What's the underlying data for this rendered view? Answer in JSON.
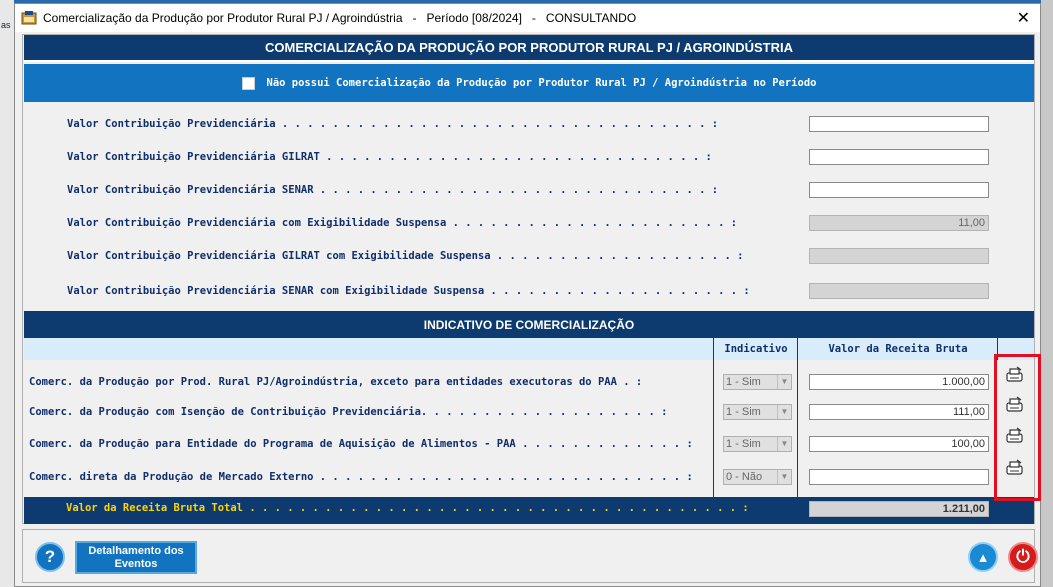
{
  "background": {
    "left_text": "as"
  },
  "window": {
    "title": "Comercialização da Produção por Produtor Rural PJ / Agroindústria   -   Período [08/2024]   -   CONSULTANDO",
    "close_glyph": "✕"
  },
  "header": {
    "title": "COMERCIALIZAÇÃO DA PRODUÇÃO POR PRODUTOR RURAL PJ / AGROINDÚSTRIA",
    "checkbox_label": "Não possui Comercialização da Produção por Produtor Rural PJ / Agroindústria no Período"
  },
  "contributions": [
    {
      "label": "Valor Contribuição Previdenciária . . . . . . . . . . . . . . . . . . . . . . . . . . . . . . . . . . :",
      "value": ""
    },
    {
      "label": "Valor Contribuição Previdenciária GILRAT . . . . . . . . . . . . . . . . . . . . . . . . . . . . . . :",
      "value": ""
    },
    {
      "label": "Valor Contribuição Previdenciária SENAR . . . . . . . . . . . . . . . . . . . . . . . . . . . . . . . :",
      "value": ""
    },
    {
      "label": "Valor Contribuição Previdenciária com Exigibilidade Suspensa . . . . . . . . . . . . . . . . . . . . . . :",
      "value": "11,00"
    },
    {
      "label": "Valor Contribuição Previdenciária GILRAT com Exigibilidade Suspensa . . . . . . . . . . . . . . . . . . . :",
      "value": ""
    },
    {
      "label": "Valor Contribuição Previdenciária SENAR com Exigibilidade Suspensa . . . . . . . . . . . . . . . . . . . . :",
      "value": ""
    }
  ],
  "indicativo": {
    "title": "INDICATIVO DE COMERCIALIZAÇÃO",
    "col_indicativo": "Indicativo",
    "col_receita": "Valor da Receita Bruta",
    "rows": [
      {
        "label": "Comerc. da Produção por Prod. Rural PJ/Agroindústria, exceto para entidades executoras do PAA . :",
        "indicativo": "1 - Sim",
        "valor": "1.000,00"
      },
      {
        "label": "Comerc. da Produção com Isenção de Contribuição Previdenciária. . . . . . . . . . . . . . . . . . . :",
        "indicativo": "1 - Sim",
        "valor": "111,00"
      },
      {
        "label": "Comerc. da Produção para Entidade do Programa de Aquisição de Alimentos - PAA . . . . . . . . . . . . . :",
        "indicativo": "1 - Sim",
        "valor": "100,00"
      },
      {
        "label": "Comerc. direta da Produção de Mercado Externo . . . . . . . . . . . . . . . . . . . . . . . . . . . . . :",
        "indicativo": "0 - Não",
        "valor": ""
      }
    ],
    "total_label": "Valor da Receita Bruta Total . . . . . . . . . . . . . . . . . . . . . . . . . . . . . . . . . . . . . . . :",
    "total_value": "1.211,00"
  },
  "footer": {
    "help_glyph": "?",
    "detail_button": "Detalhamento dos Eventos",
    "up_glyph": "▲",
    "power_glyph": "⏻"
  }
}
